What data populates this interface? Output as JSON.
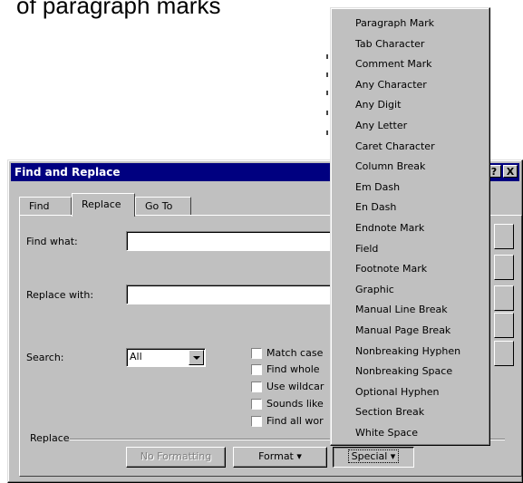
{
  "background": {
    "top_text": "of paragraph marks"
  },
  "dialog": {
    "title": "Find and Replace",
    "help_button": "?",
    "close_button": "X",
    "tabs": [
      {
        "label": "Find",
        "active": false
      },
      {
        "label": "Replace",
        "active": true
      },
      {
        "label": "Go To",
        "active": false
      }
    ],
    "find_label": "Find what:",
    "find_value": "",
    "replace_label": "Replace with:",
    "replace_value": "",
    "search_label": "Search:",
    "search_value": "All",
    "options": [
      {
        "label": "Match case",
        "checked": false
      },
      {
        "label": "Find whole",
        "checked": false
      },
      {
        "label": "Use wildcar",
        "checked": false
      },
      {
        "label": "Sounds like",
        "checked": false
      },
      {
        "label": "Find all wor",
        "checked": false
      }
    ],
    "replace_group_label": "Replace",
    "buttons": {
      "no_formatting": "No Formatting",
      "format": "Format ▾",
      "special": "Special ▾"
    }
  },
  "special_menu": {
    "items": [
      "Paragraph Mark",
      "Tab Character",
      "Comment Mark",
      "Any Character",
      "Any Digit",
      "Any Letter",
      "Caret Character",
      "Column Break",
      "Em Dash",
      "En Dash",
      "Endnote Mark",
      "Field",
      "Footnote Mark",
      "Graphic",
      "Manual Line Break",
      "Manual Page Break",
      "Nonbreaking Hyphen",
      "Nonbreaking Space",
      "Optional Hyphen",
      "Section Break",
      "White Space"
    ]
  },
  "colors": {
    "titlebar": "#000080",
    "face": "#c0c0c0",
    "disabled_text": "#808080"
  }
}
